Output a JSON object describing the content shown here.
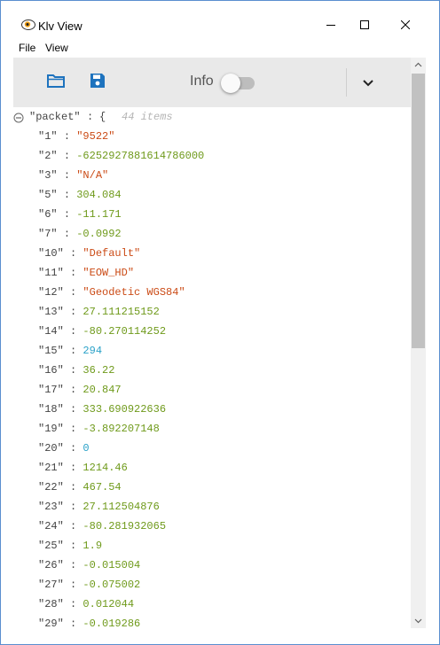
{
  "window": {
    "title": "Klv View"
  },
  "menu": {
    "file": "File",
    "view": "View"
  },
  "toolbar": {
    "info_label": "Info",
    "info_toggle_on": false,
    "accent": "#1e73be"
  },
  "tree": {
    "root_key": "\"packet\"",
    "colon": ":",
    "brace": "{",
    "count": "44 items",
    "rows": [
      {
        "key": "\"1\"",
        "value": "\"9522\"",
        "kind": "str"
      },
      {
        "key": "\"2\"",
        "value": "-6252927881614786000",
        "kind": "num"
      },
      {
        "key": "\"3\"",
        "value": "\"N/A\"",
        "kind": "str"
      },
      {
        "key": "\"5\"",
        "value": "304.084",
        "kind": "num"
      },
      {
        "key": "\"6\"",
        "value": "-11.171",
        "kind": "num"
      },
      {
        "key": "\"7\"",
        "value": "-0.0992",
        "kind": "num"
      },
      {
        "key": "\"10\"",
        "value": "\"Default\"",
        "kind": "str"
      },
      {
        "key": "\"11\"",
        "value": "\"EOW_HD\"",
        "kind": "str"
      },
      {
        "key": "\"12\"",
        "value": "\"Geodetic WGS84\"",
        "kind": "str"
      },
      {
        "key": "\"13\"",
        "value": "27.111215152",
        "kind": "num"
      },
      {
        "key": "\"14\"",
        "value": "-80.270114252",
        "kind": "num"
      },
      {
        "key": "\"15\"",
        "value": "294",
        "kind": "int"
      },
      {
        "key": "\"16\"",
        "value": "36.22",
        "kind": "num"
      },
      {
        "key": "\"17\"",
        "value": "20.847",
        "kind": "num"
      },
      {
        "key": "\"18\"",
        "value": "333.690922636",
        "kind": "num"
      },
      {
        "key": "\"19\"",
        "value": "-3.892207148",
        "kind": "num"
      },
      {
        "key": "\"20\"",
        "value": "0",
        "kind": "int"
      },
      {
        "key": "\"21\"",
        "value": "1214.46",
        "kind": "num"
      },
      {
        "key": "\"22\"",
        "value": "467.54",
        "kind": "num"
      },
      {
        "key": "\"23\"",
        "value": "27.112504876",
        "kind": "num"
      },
      {
        "key": "\"24\"",
        "value": "-80.281932065",
        "kind": "num"
      },
      {
        "key": "\"25\"",
        "value": "1.9",
        "kind": "num"
      },
      {
        "key": "\"26\"",
        "value": "-0.015004",
        "kind": "num"
      },
      {
        "key": "\"27\"",
        "value": "-0.075002",
        "kind": "num"
      },
      {
        "key": "\"28\"",
        "value": "0.012044",
        "kind": "num"
      },
      {
        "key": "\"29\"",
        "value": "-0.019286",
        "kind": "num"
      }
    ]
  }
}
